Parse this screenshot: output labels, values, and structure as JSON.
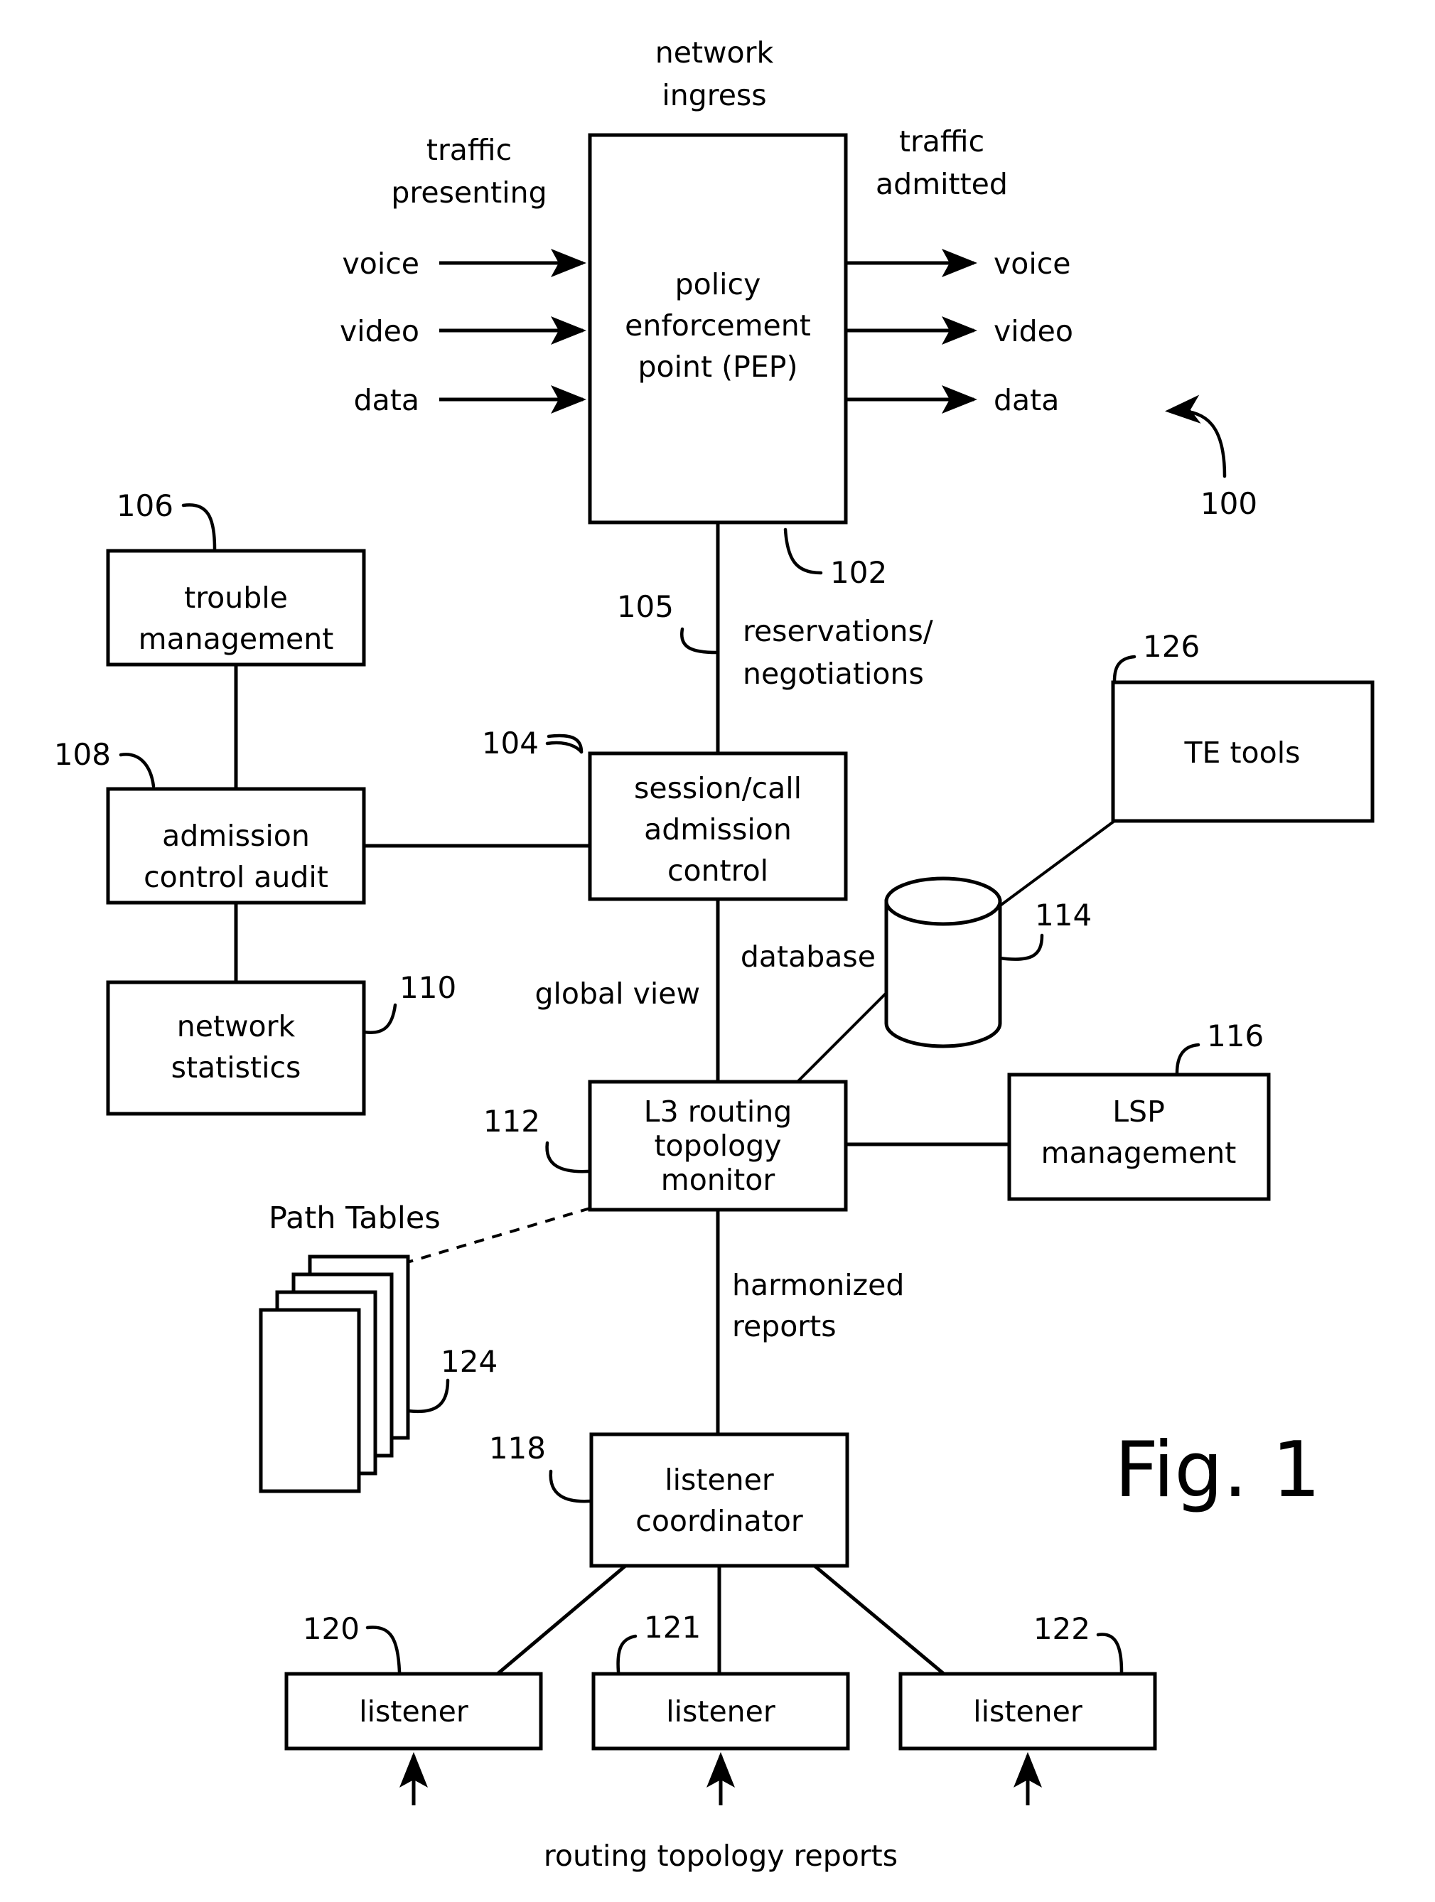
{
  "figure": {
    "label": "Fig. 1",
    "system_ref": "100"
  },
  "labels": {
    "network_ingress_line1": "network",
    "network_ingress_line2": "ingress",
    "traffic_presenting_line1": "traffic",
    "traffic_presenting_line2": "presenting",
    "traffic_admitted_line1": "traffic",
    "traffic_admitted_line2": "admitted",
    "reservations_line1": "reservations/",
    "reservations_line2": "negotiations",
    "global_view": "global view",
    "database": "database",
    "harmonized_line1": "harmonized",
    "harmonized_line2": "reports",
    "path_tables": "Path Tables",
    "routing_topology_reports": "routing topology reports"
  },
  "inputs": [
    {
      "name": "voice",
      "ref": "input-voice"
    },
    {
      "name": "video",
      "ref": "input-video"
    },
    {
      "name": "data",
      "ref": "input-data"
    }
  ],
  "outputs": [
    {
      "name": "voice",
      "ref": "output-voice"
    },
    {
      "name": "video",
      "ref": "output-video"
    },
    {
      "name": "data",
      "ref": "output-data"
    }
  ],
  "boxes": {
    "pep": {
      "line1": "policy",
      "line2": "enforcement",
      "line3": "point (PEP)",
      "ref": "102"
    },
    "trouble_management": {
      "line1": "trouble",
      "line2": "management",
      "ref": "106"
    },
    "admission_control_audit": {
      "line1": "admission",
      "line2": "control audit",
      "ref": "108"
    },
    "network_statistics": {
      "line1": "network",
      "line2": "statistics",
      "ref": "110"
    },
    "session_call_admission_control": {
      "line1": "session/call",
      "line2": "admission",
      "line3": "control",
      "ref": "104"
    },
    "te_tools": {
      "line1": "TE tools",
      "ref": "126"
    },
    "database": {
      "label": "database",
      "ref": "114"
    },
    "lsp_management": {
      "line1": "LSP",
      "line2": "management",
      "ref": "116"
    },
    "l3_routing_topology_monitor": {
      "line1": "L3 routing",
      "line2": "topology",
      "line3": "monitor",
      "ref": "112"
    },
    "path_tables": {
      "label": "Path Tables",
      "ref": "124"
    },
    "listener_coordinator": {
      "line1": "listener",
      "line2": "coordinator",
      "ref": "118"
    },
    "listener_left": {
      "label": "listener",
      "ref": "120"
    },
    "listener_center": {
      "label": "listener",
      "ref": "121"
    },
    "listener_right": {
      "label": "listener",
      "ref": "122"
    }
  },
  "connection_labels": {
    "pep_to_sac": "reservations/ negotiations",
    "sac_to_l3": "global view",
    "l3_to_coordinator": "harmonized reports"
  },
  "colors": {
    "ink": "#000000",
    "paper": "#ffffff"
  }
}
